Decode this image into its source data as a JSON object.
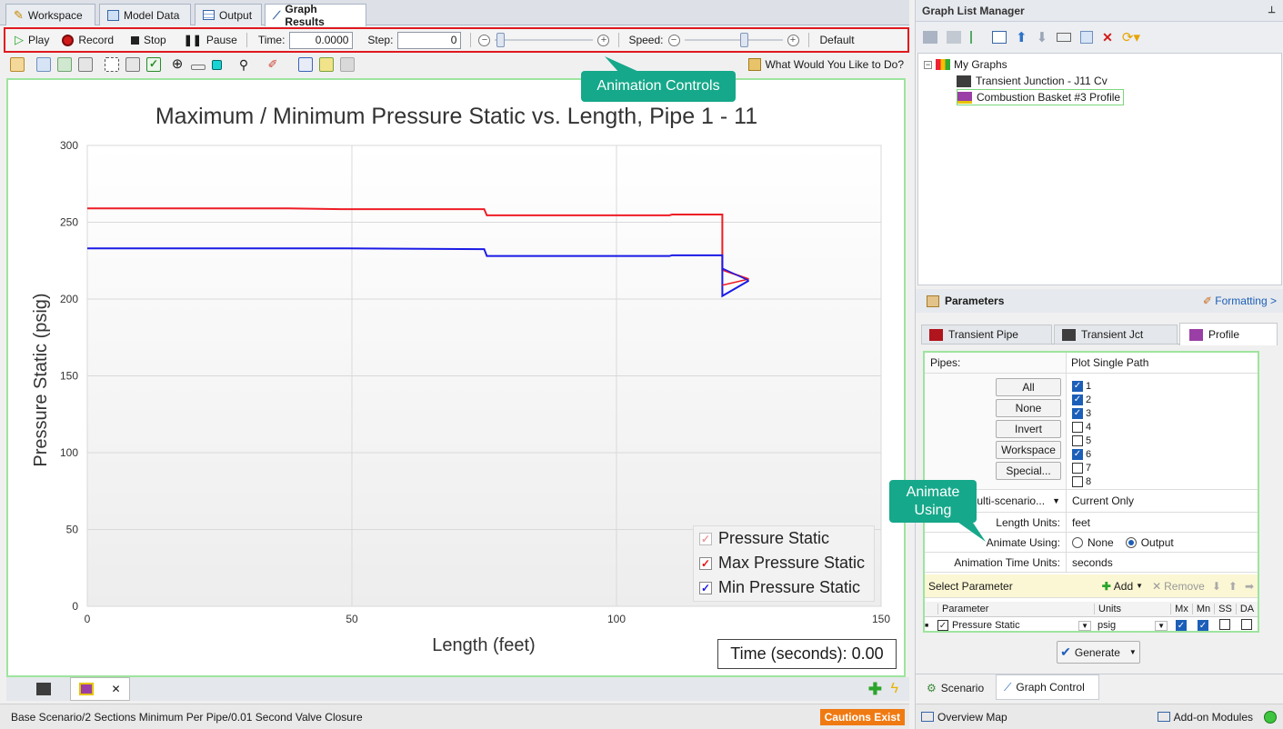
{
  "tabs": [
    {
      "label": "Workspace",
      "icon": "workspace-icon"
    },
    {
      "label": "Model Data",
      "icon": "model-data-icon"
    },
    {
      "label": "Output",
      "icon": "output-icon"
    },
    {
      "label": "Graph Results",
      "icon": "graph-results-icon"
    }
  ],
  "animation": {
    "play": "Play",
    "record": "Record",
    "stop": "Stop",
    "pause": "Pause",
    "time_label": "Time:",
    "time_value": "0.0000",
    "step_label": "Step:",
    "step_value": "0",
    "speed_label": "Speed:",
    "default_label": "Default"
  },
  "toolbar2": {
    "help_text": "What Would You Like to Do?"
  },
  "callouts": {
    "animation_controls": "Animation Controls",
    "animate_using": "Animate Using"
  },
  "chart_data": {
    "type": "line",
    "title": "Maximum / Minimum Pressure Static vs. Length, Pipe 1 - 11",
    "xlabel": "Length (feet)",
    "ylabel": "Pressure Static (psig)",
    "xlim": [
      0,
      150
    ],
    "ylim": [
      0,
      300
    ],
    "xticks": [
      "0",
      "50",
      "100",
      "150"
    ],
    "yticks": [
      "0",
      "50",
      "100",
      "150",
      "200",
      "250",
      "300"
    ],
    "grid": true,
    "legend_position": "bottom-right",
    "series": [
      {
        "name": "Pressure Static",
        "color": "#e23b3b",
        "x": [],
        "y": []
      },
      {
        "name": "Max Pressure Static",
        "color": "#ee1c25",
        "x": [
          0,
          38,
          48,
          75,
          75.5,
          110,
          110.5,
          120,
          120,
          125
        ],
        "y": [
          259,
          259,
          258.5,
          258.5,
          254.5,
          254.5,
          255,
          255,
          219,
          213
        ]
      },
      {
        "name": "Min Pressure Static",
        "color": "#1a1ae6",
        "x": [
          0,
          48,
          75,
          75.5,
          110,
          110.5,
          120,
          120,
          125
        ],
        "y": [
          233,
          233,
          232.5,
          228,
          228,
          228.5,
          228.5,
          202,
          212
        ]
      }
    ],
    "extra_lines": [
      {
        "color": "#ee1c25",
        "x": [
          120,
          125
        ],
        "y": [
          209,
          213
        ]
      },
      {
        "color": "#1a1ae6",
        "x": [
          120,
          125
        ],
        "y": [
          220,
          212
        ]
      }
    ]
  },
  "time_readout": "Time (seconds): 0.00",
  "status": {
    "scenario": "Base Scenario/2 Sections Minimum Per Pipe/0.01 Second Valve Closure",
    "cautions": "Cautions Exist"
  },
  "graph_list": {
    "title": "Graph List Manager",
    "root": "My Graphs",
    "items": [
      "Transient Junction - J11 Cv",
      "Combustion Basket #3 Profile"
    ]
  },
  "parameters": {
    "title": "Parameters",
    "formatting": "Formatting >",
    "tabs": [
      "Transient Pipe",
      "Transient Jct",
      "Profile"
    ],
    "pipes_label": "Pipes:",
    "pipes_value": "Plot Single Path",
    "buttons": [
      "All",
      "None",
      "Invert",
      "Workspace",
      "Special..."
    ],
    "pipe_list": [
      {
        "label": "1",
        "checked": true
      },
      {
        "label": "2",
        "checked": true
      },
      {
        "label": "3",
        "checked": true
      },
      {
        "label": "4",
        "checked": false
      },
      {
        "label": "5",
        "checked": false
      },
      {
        "label": "6",
        "checked": true
      },
      {
        "label": "7",
        "checked": false
      },
      {
        "label": "8",
        "checked": false
      }
    ],
    "multi_scenario": "ulti-scenario...",
    "current_only": "Current Only",
    "length_units_label": "Length Units:",
    "length_units_value": "feet",
    "animate_using_label": "Animate Using:",
    "animate_none": "None",
    "animate_output": "Output",
    "anim_time_units_label": "Animation Time Units:",
    "anim_time_units_value": "seconds",
    "select_parameter": "Select Parameter",
    "add": "Add",
    "remove": "Remove",
    "columns": [
      "Parameter",
      "Units",
      "Mx",
      "Mn",
      "SS",
      "DA"
    ],
    "row": {
      "parameter": "Pressure Static",
      "units": "psig"
    },
    "generate": "Generate"
  },
  "bottom_tabs": {
    "scenario": "Scenario",
    "graph_control": "Graph Control"
  },
  "footer": {
    "overview_map": "Overview Map",
    "addon_modules": "Add-on Modules"
  }
}
